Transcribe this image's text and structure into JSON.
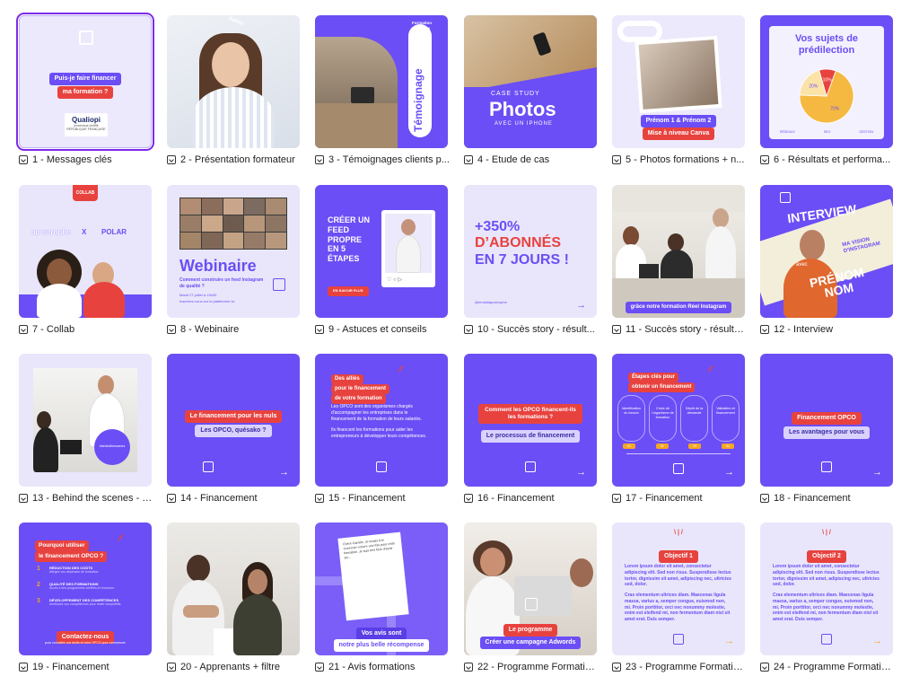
{
  "colors": {
    "accent": "#6b4ef5",
    "red": "#e8423f",
    "lavender": "#e9e6fb",
    "selection": "#7d2ae8"
  },
  "tiles": [
    {
      "caption": "1 - Messages clés",
      "pill_1": "Puis-je faire financer",
      "pill_2": "ma formation ?",
      "logo": "Qualiopi",
      "logo_sub": "processus certifié",
      "logo_sub2": "RÉPUBLIQUE FRANÇAISE"
    },
    {
      "caption": "2 - Présentation formateur",
      "tag": "Salma"
    },
    {
      "caption": "3 - Témoignages clients p...",
      "vertical": "Témoignage",
      "side": "Formation Réseaux Sociaux"
    },
    {
      "caption": "4 - Etude de cas",
      "kicker": "CASE STUDY",
      "title": "Photos",
      "sub": "AVEC UN IPHONE"
    },
    {
      "caption": "5 - Photos formations + n...",
      "pill_1": "Prénom 1 & Prénom 2",
      "pill_2": "Mise à niveau Canva"
    },
    {
      "caption": "6 - Résultats et performa...",
      "title": "Vos sujets de prédilection",
      "slice_labels": [
        "70%",
        "20%",
        "10%"
      ],
      "slice_values": [
        70,
        20,
        10
      ],
      "legend": [
        "RÉSEAUX",
        "SEO",
        "GESTION"
      ]
    },
    {
      "caption": "7 - Collab",
      "tag": "COLLAB",
      "brand_1": "apostrophe",
      "x": "X",
      "brand_2": "POLAR"
    },
    {
      "caption": "8 - Webinaire",
      "title": "Webinaire",
      "sub": "Comment construire un feed Instagram de qualité ?",
      "date": "Mardi 27 juillet à 19h30",
      "note": "Inscrivez-vous sur la plateforme ici"
    },
    {
      "caption": "9 - Astuces et conseils",
      "title": "CRÉER UN FEED PROPRE EN 5 ÉTAPES",
      "button": "EN SAVOIR PLUS"
    },
    {
      "caption": "10 - Succès story - résult...",
      "title_1": "+350%",
      "title_2": "D’ABONNÉS",
      "title_3": "EN 7 JOURS !",
      "handle": "@emailaapostrophe"
    },
    {
      "caption": "11 - Succès story - résulta...",
      "banner": "grâce notre formation Réel Instagram"
    },
    {
      "caption": "12 - Interview",
      "title": "INTERVIEW",
      "sub_1": "MA VISION",
      "sub_2": "D'INSTAGRAM",
      "name_1": "PRÉNOM",
      "name_2": "NOM",
      "avec": "avec"
    },
    {
      "caption": "13 - Behind the scenes - B...",
      "stamp": "#behindthescenes"
    },
    {
      "caption": "14 - Financement",
      "pill_1": "Le financement pour les nuls",
      "pill_2": "Les OPCO, quésako ?"
    },
    {
      "caption": "15 - Financement",
      "pill_1": "Des alliés",
      "pill_2": "pour le financement",
      "pill_3": "de votre formation",
      "p1": "Les OPCO sont des organismes chargés d'accompagner les entreprises dans le financement de la formation de leurs salariés.",
      "p2": "Ils financent les formations pour aider les entrepreneurs à développer leurs compétences."
    },
    {
      "caption": "16 - Financement",
      "pill_1": "Comment les OPCO financent-ils les formations ?",
      "pill_2": "Le processus de financement"
    },
    {
      "caption": "17 - Financement",
      "pill_1": "Étapes clés pour",
      "pill_2": "obtenir un financement",
      "steps": [
        "Identification du besoin",
        "Choix de l'organisme de formation",
        "Dépôt de la demande",
        "Validation et financement"
      ],
      "step_tags": [
        "01",
        "02",
        "03",
        "04"
      ]
    },
    {
      "caption": "18 - Financement",
      "pill_1": "Financement OPCO",
      "pill_2": "Les avantages pour vous"
    },
    {
      "caption": "19 - Financement",
      "pill_1": "Pourquoi utiliser",
      "pill_2": "le financement OPCO ?",
      "items": [
        {
          "n": "1",
          "t": "RÉDUCTION DES COÛTS",
          "d": "Allégez vos dépenses de formation."
        },
        {
          "n": "2",
          "t": "QUALITÉ DES FORMATIONS",
          "d": "Accès à des programmes certifiés et reconnus."
        },
        {
          "n": "3",
          "t": "DÉVELOPPEMENT DES COMPÉTENCES",
          "d": "Améliorez vos compétences pour rester compétitifs."
        }
      ],
      "button": "Contactez-nous",
      "footer": "pour connaître vos droits et votre OPCO pour commencer"
    },
    {
      "caption": "20 - Apprenants + filtre"
    },
    {
      "caption": "21 - Avis formations",
      "quote": "Chère Camille, Je tenais à te remercier encore une fois pour cette formation. Je suis très fière d'avoir pu...",
      "pill_1": "Vos avis sont",
      "pill_2": "notre plus belle récompense"
    },
    {
      "caption": "22 - Programme Formatio...",
      "pill_1": "Le programme",
      "pill_2": "Créer une campagne Adwords"
    },
    {
      "caption": "23 - Programme Formatio...",
      "pill": "Objectif 1",
      "p1": "Lorem ipsum dolor sit amet, consectetur adipiscing elit. Sed non risus. Suspendisse lectus tortor, dignissim sit amet, adipiscing nec, ultricies sed, dolor.",
      "p2": "Cras elementum ultrices diam. Maecenas ligula massa, varius a, semper congue, euismod non, mi. Proin porttitor, orci nec nonummy molestie, enim est eleifend mi, non fermentum diam nisl sit amet erat. Duis semper."
    },
    {
      "caption": "24 - Programme Formatio...",
      "pill": "Objectif 2",
      "p1": "Lorem ipsum dolor sit amet, consectetur adipiscing elit. Sed non risus. Suspendisse lectus tortor, dignissim sit amet, adipiscing nec, ultricies sed, dolor.",
      "p2": "Cras elementum ultrices diam. Maecenas ligula massa, varius a, semper congue, euismod non, mi. Proin porttitor, orci nec nonummy molestie, enim est eleifend mi, non fermentum diam nisl sit amet erat. Duis semper."
    }
  ]
}
